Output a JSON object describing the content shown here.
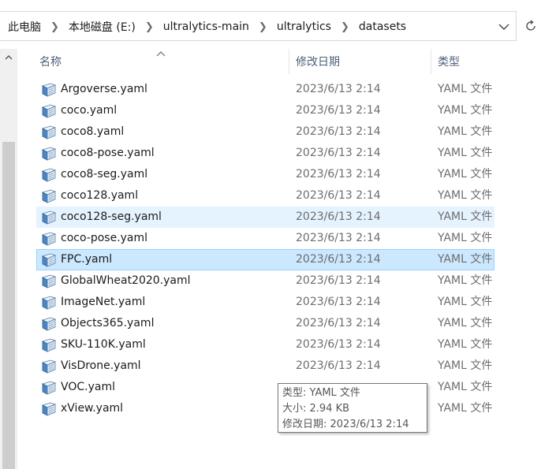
{
  "breadcrumb": [
    "此电脑",
    "本地磁盘 (E:)",
    "ultralytics-main",
    "ultralytics",
    "datasets"
  ],
  "header": {
    "name": "名称",
    "date": "修改日期",
    "type": "类型"
  },
  "files": [
    {
      "name": "Argoverse.yaml",
      "date": "2023/6/13 2:14",
      "type": "YAML 文件",
      "state": ""
    },
    {
      "name": "coco.yaml",
      "date": "2023/6/13 2:14",
      "type": "YAML 文件",
      "state": ""
    },
    {
      "name": "coco8.yaml",
      "date": "2023/6/13 2:14",
      "type": "YAML 文件",
      "state": ""
    },
    {
      "name": "coco8-pose.yaml",
      "date": "2023/6/13 2:14",
      "type": "YAML 文件",
      "state": ""
    },
    {
      "name": "coco8-seg.yaml",
      "date": "2023/6/13 2:14",
      "type": "YAML 文件",
      "state": ""
    },
    {
      "name": "coco128.yaml",
      "date": "2023/6/13 2:14",
      "type": "YAML 文件",
      "state": ""
    },
    {
      "name": "coco128-seg.yaml",
      "date": "2023/6/13 2:14",
      "type": "YAML 文件",
      "state": "hover"
    },
    {
      "name": "coco-pose.yaml",
      "date": "2023/6/13 2:14",
      "type": "YAML 文件",
      "state": ""
    },
    {
      "name": "FPC.yaml",
      "date": "2023/6/13 2:14",
      "type": "YAML 文件",
      "state": "selected"
    },
    {
      "name": "GlobalWheat2020.yaml",
      "date": "2023/6/13 2:14",
      "type": "YAML 文件",
      "state": ""
    },
    {
      "name": "ImageNet.yaml",
      "date": "2023/6/13 2:14",
      "type": "YAML 文件",
      "state": ""
    },
    {
      "name": "Objects365.yaml",
      "date": "2023/6/13 2:14",
      "type": "YAML 文件",
      "state": ""
    },
    {
      "name": "SKU-110K.yaml",
      "date": "2023/6/13 2:14",
      "type": "YAML 文件",
      "state": ""
    },
    {
      "name": "VisDrone.yaml",
      "date": "2023/6/13 2:14",
      "type": "YAML 文件",
      "state": ""
    },
    {
      "name": "VOC.yaml",
      "date": "",
      "type": "YAML 文件",
      "state": ""
    },
    {
      "name": "xView.yaml",
      "date": "",
      "type": "YAML 文件",
      "state": ""
    }
  ],
  "tooltip": {
    "type": "类型: YAML 文件",
    "size": "大小: 2.94 KB",
    "modified": "修改日期: 2023/6/13 2:14"
  },
  "icons": {
    "breadcrumb_separator": "chevron-right-icon",
    "address_dropdown": "chevron-down-icon",
    "refresh": "refresh-icon",
    "file": "yaml-file-icon",
    "sort": "sort-ascending-icon"
  },
  "colors": {
    "hover_row": "#e5f3ff",
    "selected_row": "#cce8ff",
    "selected_border": "#99d1ff",
    "header_text": "#4c607a"
  }
}
